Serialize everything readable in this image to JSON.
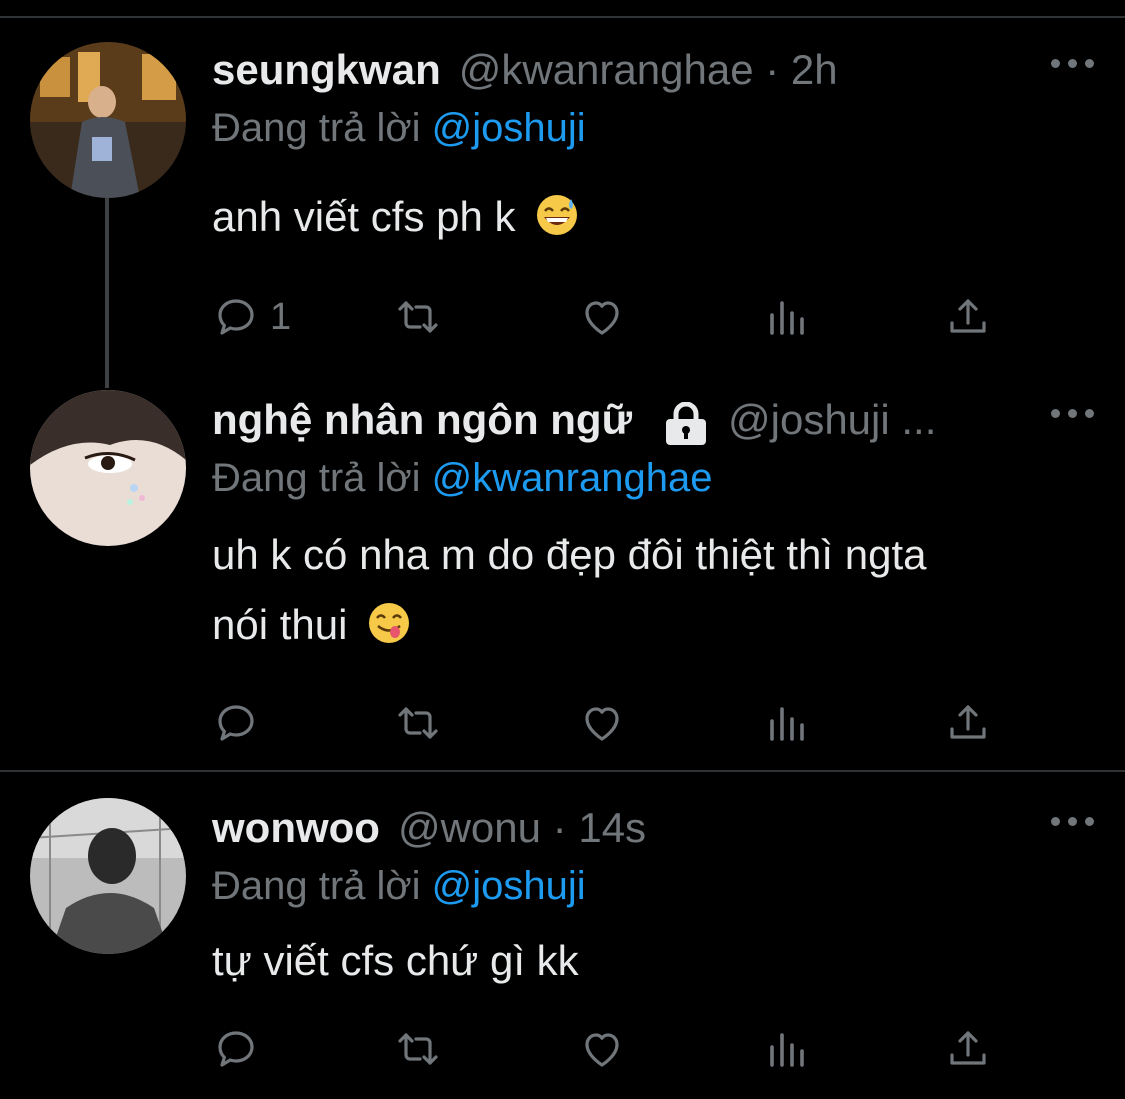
{
  "tweets": [
    {
      "name": "seungkwan",
      "handle_meta": "@kwanranghae · 2h",
      "reply_prefix": "Đang trả lời",
      "reply_mention": "@joshuji",
      "text": "anh viết cfs ph k",
      "emoji": "grinning-sweat-emoji",
      "reply_count": "1"
    },
    {
      "name": "nghệ nhân ngôn ngữ",
      "handle_meta": "@joshuji ...",
      "reply_prefix": "Đang trả lời",
      "reply_mention": "@kwanranghae",
      "text_line1": "uh k có nha m do đẹp đôi thiệt thì ngta",
      "text_line2": "nói thui",
      "emoji": "yum-emoji",
      "protected_icon": "lock-icon"
    },
    {
      "name": "wonwoo",
      "handle_meta": "@wonu · 14s",
      "reply_prefix": "Đang trả lời",
      "reply_mention": "@joshuji",
      "text": "tự viết cfs chứ gì kk"
    }
  ],
  "icons": {
    "reply": "reply-icon",
    "retweet": "retweet-icon",
    "like": "heart-icon",
    "views": "views-icon",
    "share": "share-icon",
    "more": "more-icon"
  },
  "colors": {
    "background": "#000000",
    "text": "#e7e9ea",
    "secondary": "#71767b",
    "accent": "#1d9bf0",
    "divider": "#2f3336"
  }
}
